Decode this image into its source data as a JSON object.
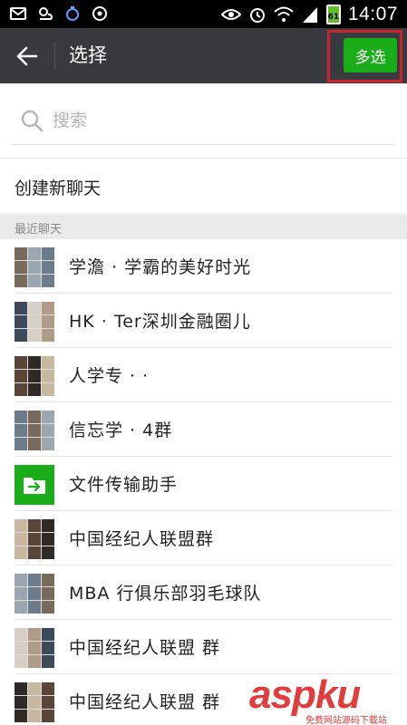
{
  "status_bar": {
    "time": "14:07",
    "battery_label": "61",
    "icons": [
      "mail-icon",
      "weather-icon",
      "alarm-app-icon",
      "app-icon",
      "eye-icon",
      "alarm-clock-icon",
      "wifi-icon",
      "signal-icon",
      "battery-icon"
    ]
  },
  "navbar": {
    "title": "选择",
    "multi_select_label": "多选"
  },
  "search": {
    "placeholder": "搜索"
  },
  "new_chat": {
    "label": "创建新聊天"
  },
  "recent": {
    "section_label": "最近聊天",
    "items": [
      {
        "name": "学澹 · 学霸的美好时光",
        "avatar": "group"
      },
      {
        "name": "HK · Ter深圳金融圈儿",
        "avatar": "group"
      },
      {
        "name": "人学专 · ·",
        "avatar": "group"
      },
      {
        "name": "信忘学 · 4群",
        "avatar": "group"
      },
      {
        "name": "文件传输助手",
        "avatar": "file-transfer"
      },
      {
        "name": "中国经纪人联盟群",
        "avatar": "group"
      },
      {
        "name": "MBA 行俱乐部羽毛球队",
        "avatar": "group"
      },
      {
        "name": "中国经纪人联盟 群",
        "avatar": "group"
      },
      {
        "name": "中国经纪人联盟 群",
        "avatar": "group"
      }
    ]
  },
  "watermark": {
    "text": "aspku",
    "subtext": "免费网站源码下载站"
  },
  "colors": {
    "navbar": "#393a3f",
    "accent_green": "#1aad19",
    "highlight_red": "#c9252f"
  }
}
